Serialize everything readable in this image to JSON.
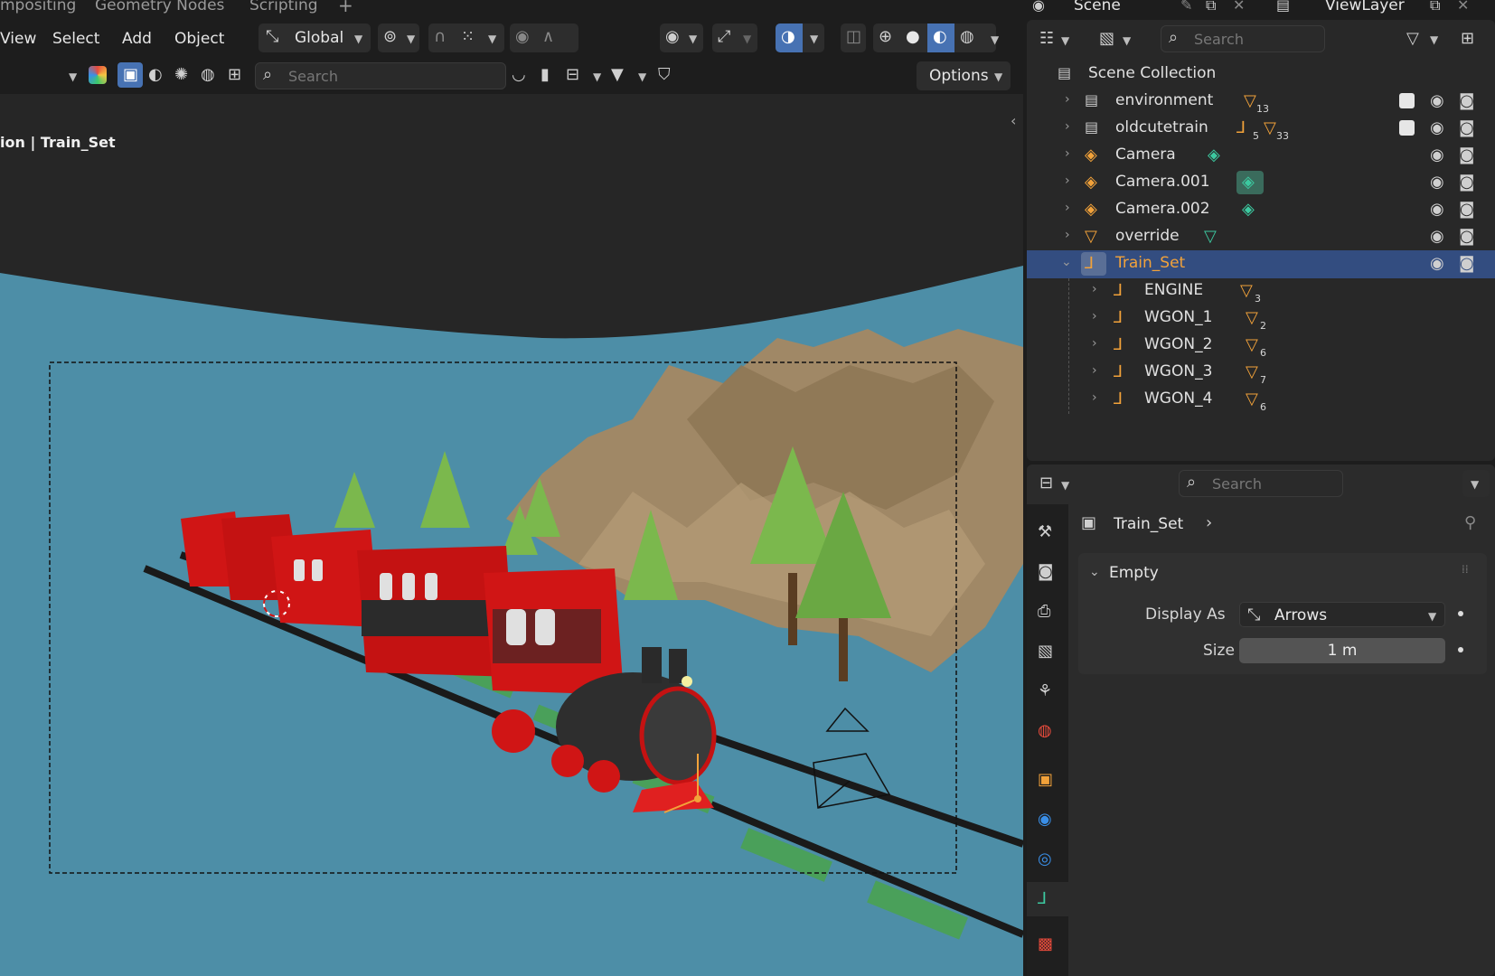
{
  "workspace_tabs": [
    "mpositing",
    "Geometry Nodes",
    "Scripting",
    "+"
  ],
  "topright": {
    "scene_label": "Scene",
    "viewlayer_label": "ViewLayer"
  },
  "viewport": {
    "menus": [
      "View",
      "Select",
      "Add",
      "Object"
    ],
    "transform_orientation": "Global",
    "search_placeholder": "Search",
    "options_label": "Options",
    "overlay_text": "ion | Train_Set"
  },
  "outliner": {
    "search_placeholder": "Search",
    "root": "Scene Collection",
    "rows": [
      {
        "name": "environment",
        "count": "13",
        "checkbox": true,
        "kind": "collection"
      },
      {
        "name": "oldcutetrain",
        "count": "5",
        "count2": "33",
        "checkbox": true,
        "kind": "collection"
      },
      {
        "name": "Camera",
        "count": "",
        "checkbox": false,
        "kind": "camera"
      },
      {
        "name": "Camera.001",
        "count": "",
        "checkbox": false,
        "kind": "camera"
      },
      {
        "name": "Camera.002",
        "count": "",
        "checkbox": false,
        "kind": "camera"
      },
      {
        "name": "override",
        "count": "",
        "checkbox": false,
        "kind": "mesh"
      },
      {
        "name": "Train_Set",
        "count": "",
        "checkbox": false,
        "kind": "empty",
        "selected": true
      },
      {
        "name": "ENGINE",
        "count": "3",
        "kind": "child"
      },
      {
        "name": "WGON_1",
        "count": "2",
        "kind": "child"
      },
      {
        "name": "WGON_2",
        "count": "6",
        "kind": "child"
      },
      {
        "name": "WGON_3",
        "count": "7",
        "kind": "child"
      },
      {
        "name": "WGON_4",
        "count": "6",
        "kind": "child"
      }
    ]
  },
  "properties": {
    "search_placeholder": "Search",
    "object_name": "Train_Set",
    "panel_title": "Empty",
    "display_as_label": "Display As",
    "display_as_value": "Arrows",
    "size_label": "Size",
    "size_value": "1 m"
  },
  "colors": {
    "accent": "#4772b3",
    "selected_row": "#334d80",
    "orange": "#f2a23a"
  }
}
